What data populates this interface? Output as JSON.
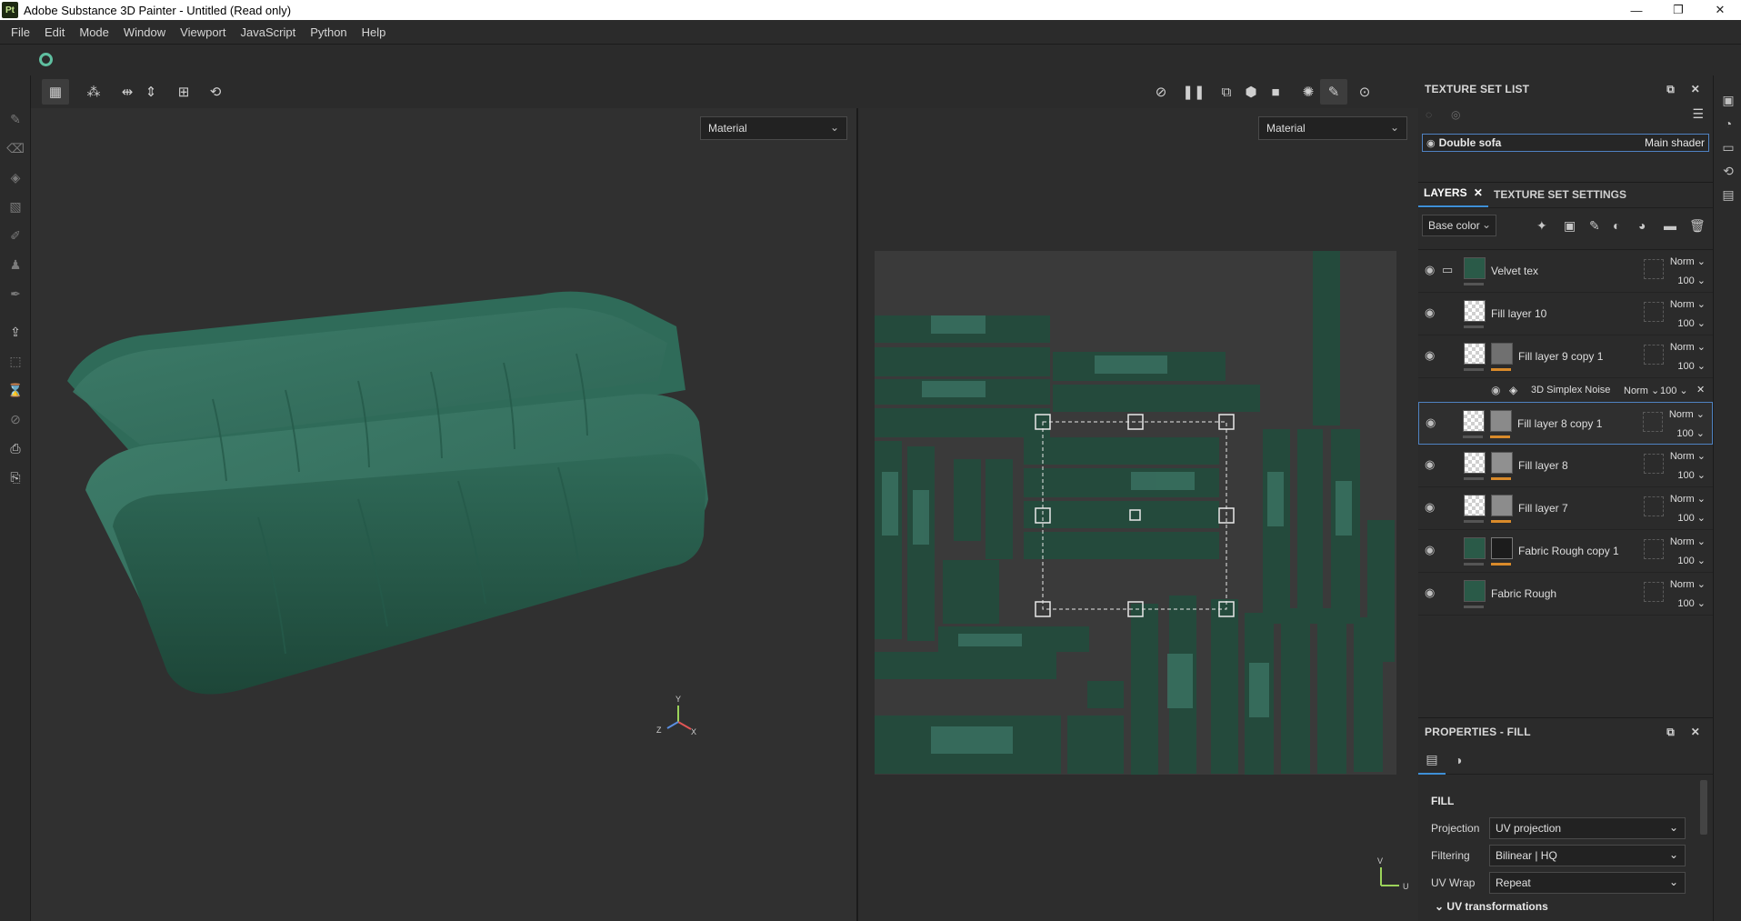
{
  "window": {
    "title": "Adobe Substance 3D Painter - Untitled (Read only)",
    "logo": "Pt",
    "minimize": "—",
    "maximize": "❐",
    "close": "✕"
  },
  "menu": [
    "File",
    "Edit",
    "Mode",
    "Window",
    "Viewport",
    "JavaScript",
    "Python",
    "Help"
  ],
  "viewport": {
    "left_mode": "Material",
    "right_mode": "Material",
    "axis_y": "Y",
    "axis_z": "Z",
    "axis_x": "X",
    "uv_v": "V",
    "uv_u": "U"
  },
  "texture_set_list": {
    "title": "TEXTURE SET LIST",
    "item_name": "Double sofa",
    "item_shader": "Main shader"
  },
  "tabs": {
    "layers": "LAYERS",
    "settings": "TEXTURE SET SETTINGS"
  },
  "channel": "Base color",
  "layers": [
    {
      "name": "Velvet tex",
      "blend": "Norm",
      "opacity": "100"
    },
    {
      "name": "Fill layer 10",
      "blend": "Norm",
      "opacity": "100"
    },
    {
      "name": "Fill layer 9 copy 1",
      "blend": "Norm",
      "opacity": "100"
    },
    {
      "name": "Fill layer 8 copy 1",
      "blend": "Norm",
      "opacity": "100"
    },
    {
      "name": "Fill layer 8",
      "blend": "Norm",
      "opacity": "100"
    },
    {
      "name": "Fill layer 7",
      "blend": "Norm",
      "opacity": "100"
    },
    {
      "name": "Fabric Rough copy 1",
      "blend": "Norm",
      "opacity": "100"
    },
    {
      "name": "Fabric Rough",
      "blend": "Norm",
      "opacity": "100"
    }
  ],
  "effect": {
    "name": "3D Simplex Noise",
    "blend": "Norm",
    "opacity": "100"
  },
  "properties": {
    "title": "PROPERTIES - FILL",
    "section": "FILL",
    "projection_label": "Projection",
    "projection_value": "UV projection",
    "filtering_label": "Filtering",
    "filtering_value": "Bilinear | HQ",
    "uvwrap_label": "UV Wrap",
    "uvwrap_value": "Repeat",
    "uv_transformations": "UV transformations"
  },
  "colors": {
    "accent": "#3e8fd6",
    "sofa": "#2f6a57",
    "mask_bar": "#d98a2a"
  }
}
